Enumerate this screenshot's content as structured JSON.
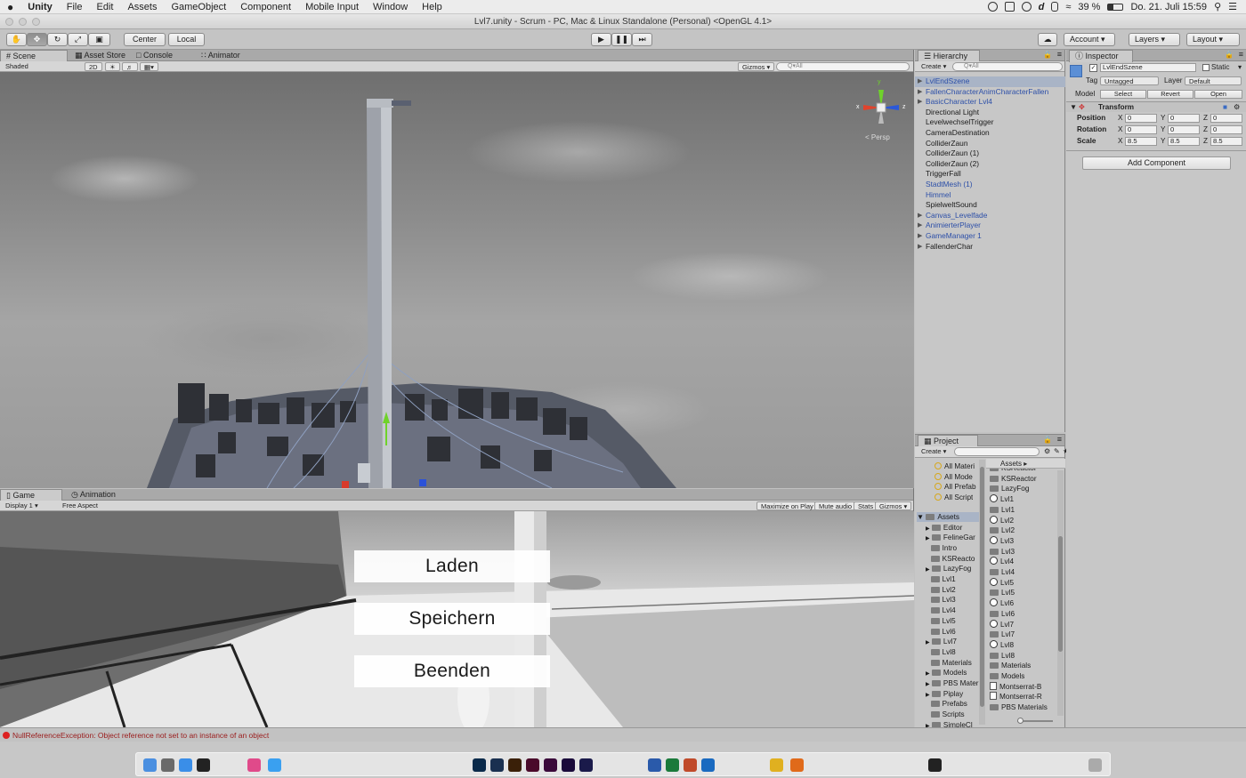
{
  "menubar": {
    "apple": "",
    "app": "Unity",
    "items": [
      "File",
      "Edit",
      "Assets",
      "GameObject",
      "Component",
      "Mobile Input",
      "Window",
      "Help"
    ],
    "battery": "39 %",
    "datetime": "Do. 21. Juli  15:59"
  },
  "window": {
    "title": "Lvl7.unity - Scrum - PC, Mac & Linux Standalone (Personal) <OpenGL 4.1>"
  },
  "toolbar": {
    "pivot": "Center",
    "space": "Local",
    "account": "Account",
    "layers": "Layers",
    "layout": "Layout"
  },
  "scene": {
    "tabs": [
      "Scene",
      "Asset Store",
      "Console",
      "Animator"
    ],
    "shading": "Shaded",
    "mode2d": "2D",
    "gizmos": "Gizmos",
    "search_placeholder": "Q▾All",
    "persp": "< Persp",
    "axis_x": "x",
    "axis_y": "y",
    "axis_z": "z"
  },
  "game": {
    "tabs": [
      "Game",
      "Animation"
    ],
    "display": "Display 1",
    "aspect": "Free Aspect",
    "maximize": "Maximize on Play",
    "mute": "Mute audio",
    "stats": "Stats",
    "gizmos": "Gizmos",
    "buttons": [
      "Laden",
      "Speichern",
      "Beenden"
    ]
  },
  "hierarchy": {
    "title": "Hierarchy",
    "create": "Create",
    "search_placeholder": "Q▾All",
    "items": [
      {
        "label": "LvlEndSzene",
        "arrow": "▶",
        "blue": true,
        "selected": true
      },
      {
        "label": "FallenCharacterAnimCharacterFallen",
        "arrow": "▶",
        "blue": true
      },
      {
        "label": "BasicCharacter Lvl4",
        "arrow": "▶",
        "blue": true
      },
      {
        "label": "Directional Light",
        "arrow": ""
      },
      {
        "label": "LevelwechselTrigger",
        "arrow": ""
      },
      {
        "label": "CameraDestination",
        "arrow": ""
      },
      {
        "label": "ColliderZaun",
        "arrow": ""
      },
      {
        "label": "ColliderZaun (1)",
        "arrow": ""
      },
      {
        "label": "ColliderZaun (2)",
        "arrow": ""
      },
      {
        "label": "TriggerFall",
        "arrow": ""
      },
      {
        "label": "StadtMesh (1)",
        "arrow": "",
        "blue": true
      },
      {
        "label": "Himmel",
        "arrow": "",
        "blue": true
      },
      {
        "label": "SpielweltSound",
        "arrow": ""
      },
      {
        "label": "Canvas_Levelfade",
        "arrow": "▶",
        "blue": true
      },
      {
        "label": "AnimierterPlayer",
        "arrow": "▶",
        "blue": true
      },
      {
        "label": "GameManager 1",
        "arrow": "▶",
        "blue": true
      },
      {
        "label": "FallenderChar",
        "arrow": "▶"
      }
    ]
  },
  "project": {
    "title": "Project",
    "create": "Create",
    "favorites": [
      "All Materi",
      "All Mode",
      "All Prefab",
      "All Script"
    ],
    "tree_root": "Assets",
    "tree": [
      "Editor",
      "FelineGar",
      "Intro",
      "KSReacto",
      "LazyFog",
      "Lvl1",
      "Lvl2",
      "Lvl3",
      "Lvl4",
      "Lvl5",
      "Lvl6",
      "Lvl7",
      "Lvl8",
      "Materials",
      "Models",
      "PBS Mater",
      "Piplay",
      "Prefabs",
      "Scripts",
      "SimpleCl"
    ],
    "breadcrumb": "Assets ▸",
    "assets": [
      {
        "label": "KSReactor",
        "icon": "folder"
      },
      {
        "label": "KSReactor",
        "icon": "folder"
      },
      {
        "label": "LazyFog",
        "icon": "folder"
      },
      {
        "label": "Lvl1",
        "icon": "unity"
      },
      {
        "label": "Lvl1",
        "icon": "folder"
      },
      {
        "label": "Lvl2",
        "icon": "unity"
      },
      {
        "label": "Lvl2",
        "icon": "folder"
      },
      {
        "label": "Lvl3",
        "icon": "unity"
      },
      {
        "label": "Lvl3",
        "icon": "folder"
      },
      {
        "label": "Lvl4",
        "icon": "unity"
      },
      {
        "label": "Lvl4",
        "icon": "folder"
      },
      {
        "label": "Lvl5",
        "icon": "unity"
      },
      {
        "label": "Lvl5",
        "icon": "folder"
      },
      {
        "label": "Lvl6",
        "icon": "unity"
      },
      {
        "label": "Lvl6",
        "icon": "folder"
      },
      {
        "label": "Lvl7",
        "icon": "unity"
      },
      {
        "label": "Lvl7",
        "icon": "folder"
      },
      {
        "label": "Lvl8",
        "icon": "unity"
      },
      {
        "label": "Lvl8",
        "icon": "folder"
      },
      {
        "label": "Materials",
        "icon": "folder"
      },
      {
        "label": "Models",
        "icon": "folder"
      },
      {
        "label": "Montserrat-B",
        "icon": "font"
      },
      {
        "label": "Montserrat-R",
        "icon": "font"
      },
      {
        "label": "PBS Materials",
        "icon": "folder"
      }
    ]
  },
  "inspector": {
    "title": "Inspector",
    "object_name": "LvlEndSzene",
    "static": "Static",
    "tag_label": "Tag",
    "tag": "Untagged",
    "layer_label": "Layer",
    "layer": "Default",
    "model_label": "Model",
    "model_buttons": [
      "Select",
      "Revert",
      "Open"
    ],
    "transform": "Transform",
    "rows": [
      {
        "label": "Position",
        "x": "0",
        "y": "0",
        "z": "0"
      },
      {
        "label": "Rotation",
        "x": "0",
        "y": "0",
        "z": "0"
      },
      {
        "label": "Scale",
        "x": "8.5",
        "y": "8.5",
        "z": "8.5"
      }
    ],
    "axis_x": "X",
    "axis_y": "Y",
    "axis_z": "Z",
    "add_component": "Add Component"
  },
  "status": {
    "message": "NullReferenceException: Object reference not set to an instance of an object"
  },
  "colors": {
    "selection": "#a9b4c6",
    "prefab_blue": "#2c4fa8",
    "error_red": "#d22222",
    "tab_active": "#cbcbcb"
  },
  "dock": {
    "apps": [
      "finder-icon",
      "launchpad-icon",
      "safari-icon",
      "terminal-icon",
      "itunes-icon",
      "appstore-icon",
      "photoshop-icon",
      "lightroom-icon",
      "illustrator-icon",
      "indesign-icon",
      "xd-icon",
      "premiere-icon",
      "aftereffects-icon",
      "word-icon",
      "excel-icon",
      "powerpoint-icon",
      "outlook-icon",
      "chrome-icon",
      "firefox-icon",
      "unity-icon",
      "trash-icon"
    ]
  }
}
